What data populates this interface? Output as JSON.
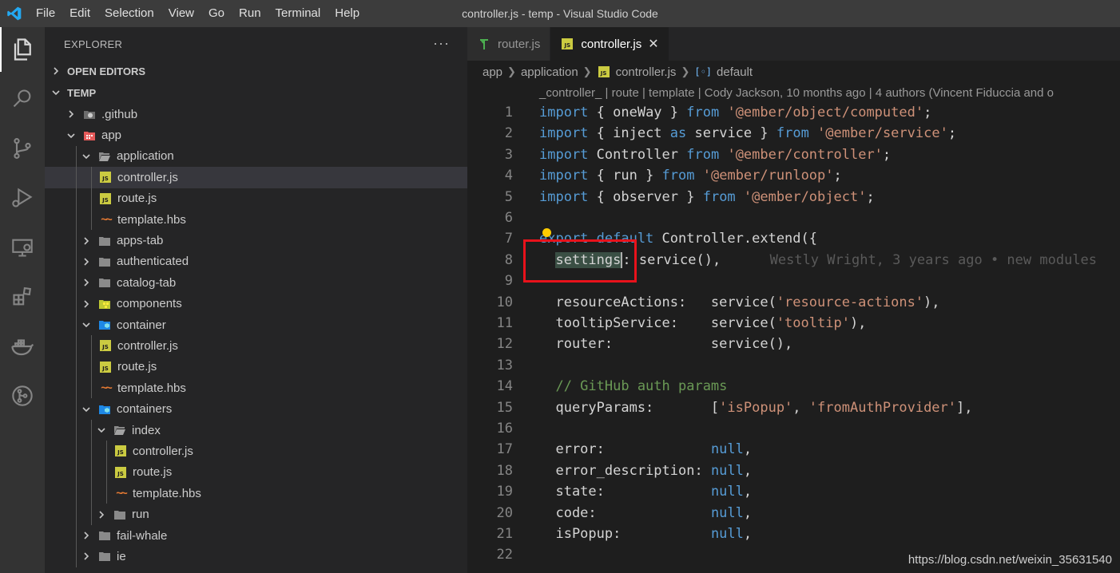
{
  "titlebar": {
    "menu": [
      "File",
      "Edit",
      "Selection",
      "View",
      "Go",
      "Run",
      "Terminal",
      "Help"
    ],
    "window_title": "controller.js - temp - Visual Studio Code"
  },
  "activitybar": {
    "icons": [
      "files-icon",
      "search-icon",
      "source-control-icon",
      "run-debug-icon",
      "remote-explorer-icon",
      "extensions-icon",
      "docker-icon",
      "gitlens-icon"
    ]
  },
  "sidebar": {
    "title": "EXPLORER",
    "more": "···",
    "open_editors": "OPEN EDITORS",
    "workspace": "TEMP",
    "tree": [
      {
        "label": ".github",
        "type": "folder",
        "icon": "github",
        "expanded": false,
        "depth": 1
      },
      {
        "label": "app",
        "type": "folder",
        "icon": "app",
        "expanded": true,
        "depth": 1
      },
      {
        "label": "application",
        "type": "folder",
        "icon": "folder-open",
        "expanded": true,
        "depth": 2
      },
      {
        "label": "controller.js",
        "type": "js",
        "depth": 3,
        "selected": true
      },
      {
        "label": "route.js",
        "type": "js",
        "depth": 3
      },
      {
        "label": "template.hbs",
        "type": "hbs",
        "depth": 3
      },
      {
        "label": "apps-tab",
        "type": "folder",
        "icon": "folder",
        "expanded": false,
        "depth": 2
      },
      {
        "label": "authenticated",
        "type": "folder",
        "icon": "folder",
        "expanded": false,
        "depth": 2
      },
      {
        "label": "catalog-tab",
        "type": "folder",
        "icon": "folder",
        "expanded": false,
        "depth": 2
      },
      {
        "label": "components",
        "type": "folder",
        "icon": "components",
        "expanded": false,
        "depth": 2
      },
      {
        "label": "container",
        "type": "folder",
        "icon": "container",
        "expanded": true,
        "depth": 2
      },
      {
        "label": "controller.js",
        "type": "js",
        "depth": 3
      },
      {
        "label": "route.js",
        "type": "js",
        "depth": 3
      },
      {
        "label": "template.hbs",
        "type": "hbs",
        "depth": 3
      },
      {
        "label": "containers",
        "type": "folder",
        "icon": "container",
        "expanded": true,
        "depth": 2
      },
      {
        "label": "index",
        "type": "folder",
        "icon": "folder-open",
        "expanded": true,
        "depth": 3
      },
      {
        "label": "controller.js",
        "type": "js",
        "depth": 4
      },
      {
        "label": "route.js",
        "type": "js",
        "depth": 4
      },
      {
        "label": "template.hbs",
        "type": "hbs",
        "depth": 4
      },
      {
        "label": "run",
        "type": "folder",
        "icon": "folder",
        "expanded": false,
        "depth": 3
      },
      {
        "label": "fail-whale",
        "type": "folder",
        "icon": "folder",
        "expanded": false,
        "depth": 2
      },
      {
        "label": "ie",
        "type": "folder",
        "icon": "folder",
        "expanded": false,
        "depth": 2
      }
    ]
  },
  "tabs": [
    {
      "label": "router.js",
      "icon": "router-icon",
      "active": false
    },
    {
      "label": "controller.js",
      "icon": "js-icon",
      "active": true,
      "close": "✕"
    }
  ],
  "breadcrumb": {
    "parts": [
      "app",
      "application",
      "controller.js",
      "default"
    ]
  },
  "editor": {
    "codelens": "_controller_ | route | template | Cody Jackson, 10 months ago | 4 authors (Vincent Fiduccia and o",
    "blame_line8": "Westly Wright, 3 years ago • new modules",
    "lines": [
      {
        "n": "1",
        "tokens": [
          [
            "k",
            "import"
          ],
          [
            "p",
            " { oneWay } "
          ],
          [
            "k",
            "from"
          ],
          [
            "p",
            " "
          ],
          [
            "s",
            "'@ember/object/computed'"
          ],
          [
            "p",
            ";"
          ]
        ]
      },
      {
        "n": "2",
        "tokens": [
          [
            "k",
            "import"
          ],
          [
            "p",
            " { inject "
          ],
          [
            "k",
            "as"
          ],
          [
            "p",
            " service } "
          ],
          [
            "k",
            "from"
          ],
          [
            "p",
            " "
          ],
          [
            "s",
            "'@ember/service'"
          ],
          [
            "p",
            ";"
          ]
        ]
      },
      {
        "n": "3",
        "tokens": [
          [
            "k",
            "import"
          ],
          [
            "p",
            " Controller "
          ],
          [
            "k",
            "from"
          ],
          [
            "p",
            " "
          ],
          [
            "s",
            "'@ember/controller'"
          ],
          [
            "p",
            ";"
          ]
        ]
      },
      {
        "n": "4",
        "tokens": [
          [
            "k",
            "import"
          ],
          [
            "p",
            " { run } "
          ],
          [
            "k",
            "from"
          ],
          [
            "p",
            " "
          ],
          [
            "s",
            "'@ember/runloop'"
          ],
          [
            "p",
            ";"
          ]
        ]
      },
      {
        "n": "5",
        "tokens": [
          [
            "k",
            "import"
          ],
          [
            "p",
            " { observer } "
          ],
          [
            "k",
            "from"
          ],
          [
            "p",
            " "
          ],
          [
            "s",
            "'@ember/object'"
          ],
          [
            "p",
            ";"
          ]
        ]
      },
      {
        "n": "6",
        "tokens": []
      },
      {
        "n": "7",
        "tokens": [
          [
            "k",
            "export default"
          ],
          [
            "p",
            " Controller.extend({"
          ]
        ]
      },
      {
        "n": "8",
        "tokens": [
          [
            "p",
            "  "
          ],
          [
            "h",
            "settings"
          ],
          [
            "p",
            ": service(),"
          ]
        ]
      },
      {
        "n": "9",
        "tokens": []
      },
      {
        "n": "10",
        "tokens": [
          [
            "p",
            "  resourceActions:   service("
          ],
          [
            "s",
            "'resource-actions'"
          ],
          [
            "p",
            "),"
          ]
        ]
      },
      {
        "n": "11",
        "tokens": [
          [
            "p",
            "  tooltipService:    service("
          ],
          [
            "s",
            "'tooltip'"
          ],
          [
            "p",
            "),"
          ]
        ]
      },
      {
        "n": "12",
        "tokens": [
          [
            "p",
            "  router:            service(),"
          ]
        ]
      },
      {
        "n": "13",
        "tokens": []
      },
      {
        "n": "14",
        "tokens": [
          [
            "c",
            "  // GitHub auth params"
          ]
        ]
      },
      {
        "n": "15",
        "tokens": [
          [
            "p",
            "  queryParams:       ["
          ],
          [
            "s",
            "'isPopup'"
          ],
          [
            "p",
            ", "
          ],
          [
            "s",
            "'fromAuthProvider'"
          ],
          [
            "p",
            "],"
          ]
        ]
      },
      {
        "n": "16",
        "tokens": []
      },
      {
        "n": "17",
        "tokens": [
          [
            "p",
            "  error:             "
          ],
          [
            "k",
            "null"
          ],
          [
            "p",
            ","
          ]
        ]
      },
      {
        "n": "18",
        "tokens": [
          [
            "p",
            "  error_description: "
          ],
          [
            "k",
            "null"
          ],
          [
            "p",
            ","
          ]
        ]
      },
      {
        "n": "19",
        "tokens": [
          [
            "p",
            "  state:             "
          ],
          [
            "k",
            "null"
          ],
          [
            "p",
            ","
          ]
        ]
      },
      {
        "n": "20",
        "tokens": [
          [
            "p",
            "  code:              "
          ],
          [
            "k",
            "null"
          ],
          [
            "p",
            ","
          ]
        ]
      },
      {
        "n": "21",
        "tokens": [
          [
            "p",
            "  isPopup:           "
          ],
          [
            "k",
            "null"
          ],
          [
            "p",
            ","
          ]
        ]
      },
      {
        "n": "22",
        "tokens": []
      }
    ]
  },
  "watermark": "https://blog.csdn.net/weixin_35631540"
}
